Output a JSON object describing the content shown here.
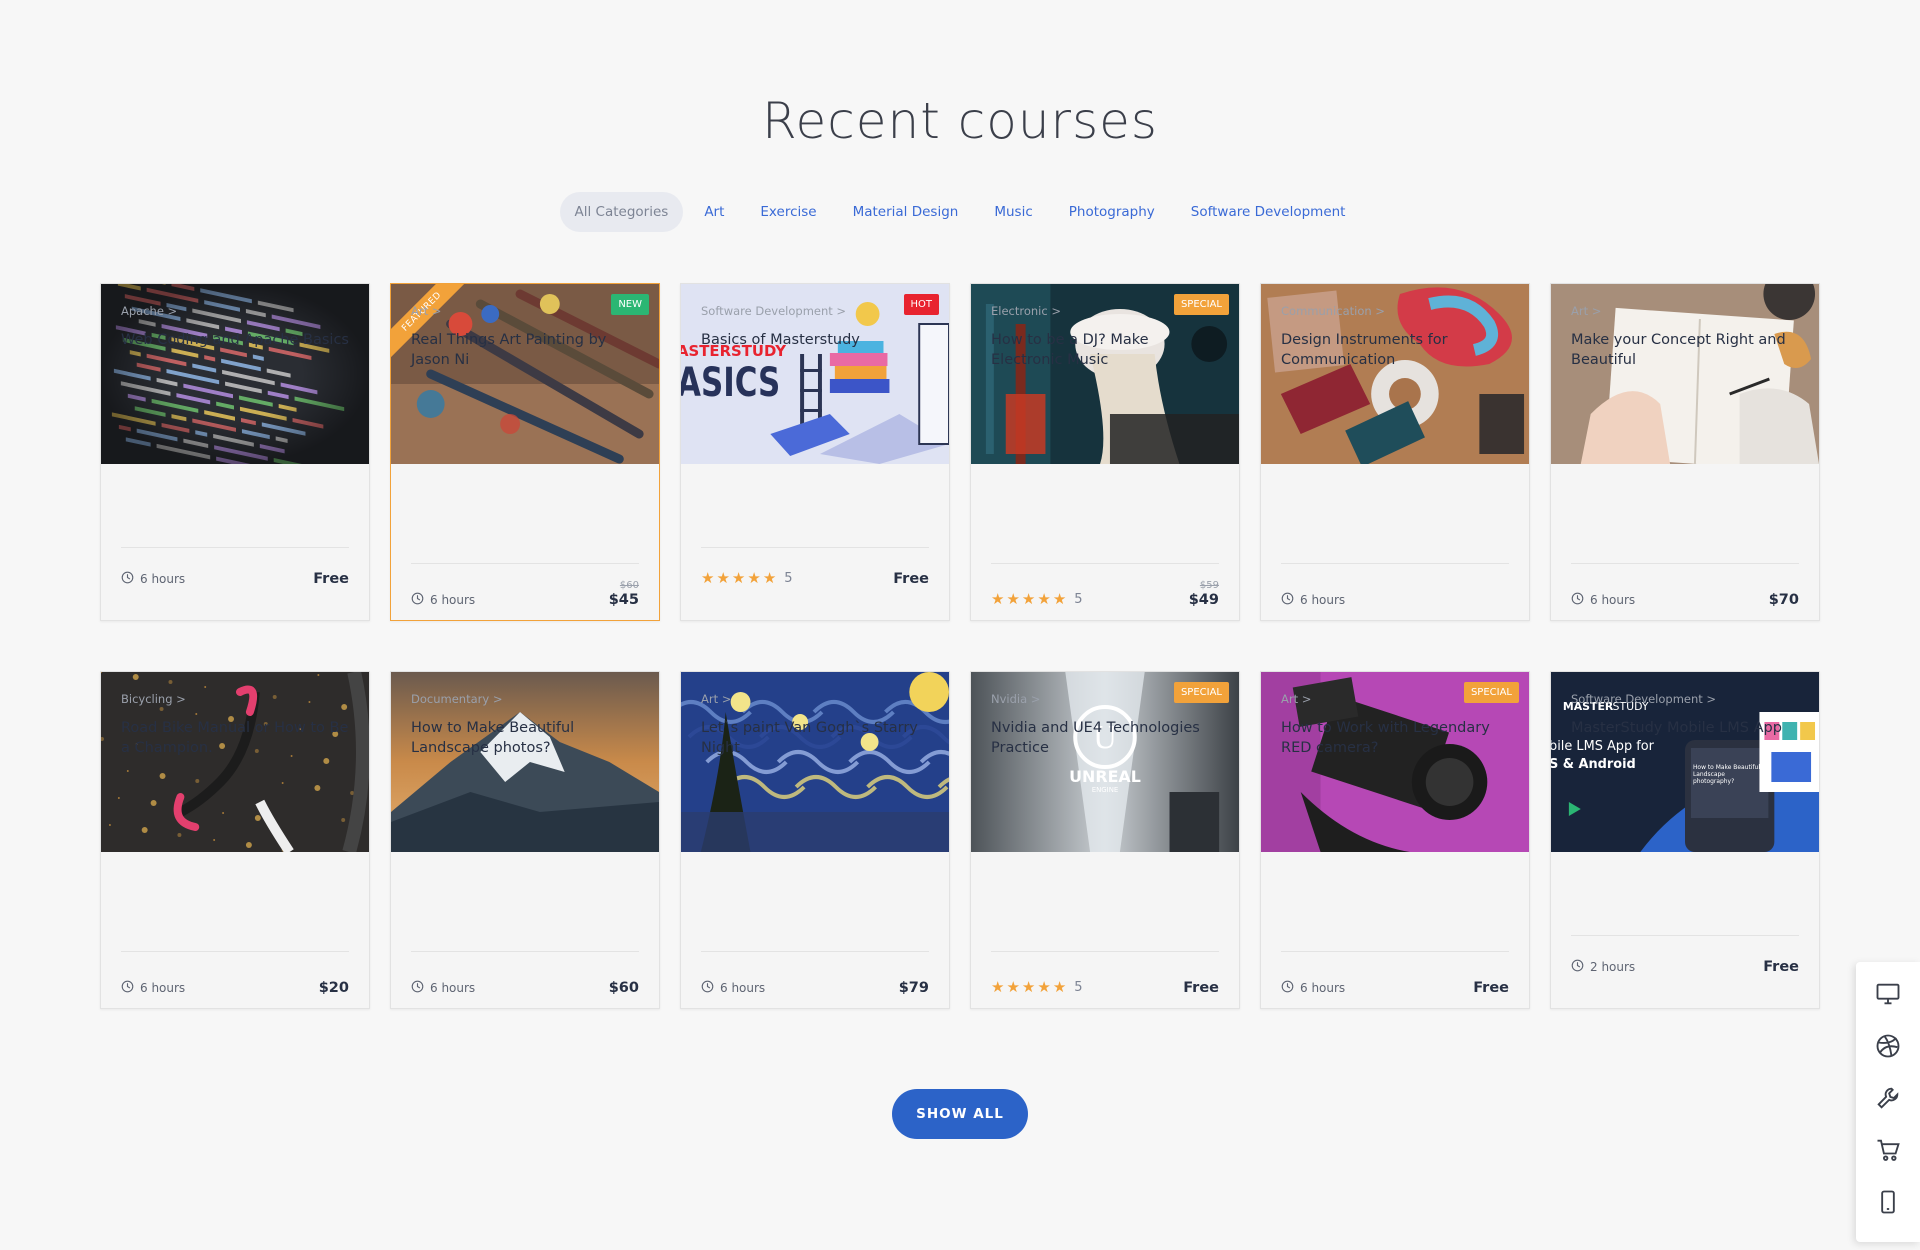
{
  "section": {
    "title": "Recent courses"
  },
  "tabs": [
    {
      "label": "All Categories",
      "active": true
    },
    {
      "label": "Art"
    },
    {
      "label": "Exercise"
    },
    {
      "label": "Material Design"
    },
    {
      "label": "Music"
    },
    {
      "label": "Photography"
    },
    {
      "label": "Software Development"
    }
  ],
  "courses": [
    {
      "category": "Apache >",
      "title": "Web Coding and Apache Basics",
      "duration": "6 hours",
      "price": "Free",
      "image": "code-screen"
    },
    {
      "category": "Art >",
      "title": "Real Things Art Painting by Jason Ni",
      "duration": "6 hours",
      "old_price": "$60",
      "price": "$45",
      "badge": "NEW",
      "badge_color": "#2bb673",
      "ribbon": "FEATURED",
      "image": "paint-brushes"
    },
    {
      "category": "Software Development >",
      "title": "Basics of Masterstudy",
      "rating": "5",
      "stars": 5,
      "price": "Free",
      "badge": "HOT",
      "badge_color": "#e8232f",
      "image": "masterstudy-basics",
      "image_text_1": "ASTERSTUDY",
      "image_text_2": "ASICS"
    },
    {
      "category": "Electronic >",
      "title": "How to be a DJ? Make Electronic Music",
      "rating": "5",
      "stars": 5,
      "old_price": "$59",
      "price": "$49",
      "badge": "SPECIAL",
      "badge_color": "#f2a23a",
      "image": "dj"
    },
    {
      "category": "Communication >",
      "title": "Design Instruments for Communication",
      "duration": "6 hours",
      "price": "",
      "image": "design-tools"
    },
    {
      "category": "Art >",
      "title": "Make your Concept Right and Beautiful",
      "duration": "6 hours",
      "price": "$70",
      "image": "notebook"
    },
    {
      "category": "Bicycling >",
      "title": "Road Bike Manual or How to Be a Champion.",
      "duration": "6 hours",
      "price": "$20",
      "image": "bike"
    },
    {
      "category": "Documentary >",
      "title": "How to Make Beautiful Landscape photos?",
      "duration": "6 hours",
      "price": "$60",
      "image": "mountain"
    },
    {
      "category": "Art >",
      "title": "Let`s paint Van Gogh`s Starry Night",
      "duration": "6 hours",
      "price": "$79",
      "image": "starry-night"
    },
    {
      "category": "Nvidia >",
      "title": "Nvidia and UE4 Technologies Practice",
      "rating": "5",
      "stars": 5,
      "price": "Free",
      "badge": "SPECIAL",
      "badge_color": "#f2a23a",
      "image": "unreal",
      "image_text_1": "UNREAL",
      "image_text_2": "ENGINE"
    },
    {
      "category": "Art >",
      "title": "How to Work with Legendary RED camera?",
      "duration": "6 hours",
      "price": "Free",
      "badge": "SPECIAL",
      "badge_color": "#f2a23a",
      "image": "camera"
    },
    {
      "category": "Software Development >",
      "title": "MasterStudy Mobile LMS App",
      "duration": "2 hours",
      "price": "Free",
      "image": "mobile-app",
      "image_text_1": "MASTER",
      "image_text_2": "STUDY",
      "image_text_3": "bile LMS App for",
      "image_text_4": "S & Android",
      "image_text_5": "How to Make Beautiful Landscape photography?"
    }
  ],
  "show_all": {
    "label": "SHOW ALL"
  },
  "sidebar": [
    {
      "icon": "monitor-icon"
    },
    {
      "icon": "dribbble-icon"
    },
    {
      "icon": "wrench-icon"
    },
    {
      "icon": "cart-icon"
    },
    {
      "icon": "mobile-icon"
    }
  ],
  "colors": {
    "accent": "#2c63c8",
    "link": "#3a6ad6",
    "star": "#f2a23a",
    "featured": "#f2a23a"
  }
}
